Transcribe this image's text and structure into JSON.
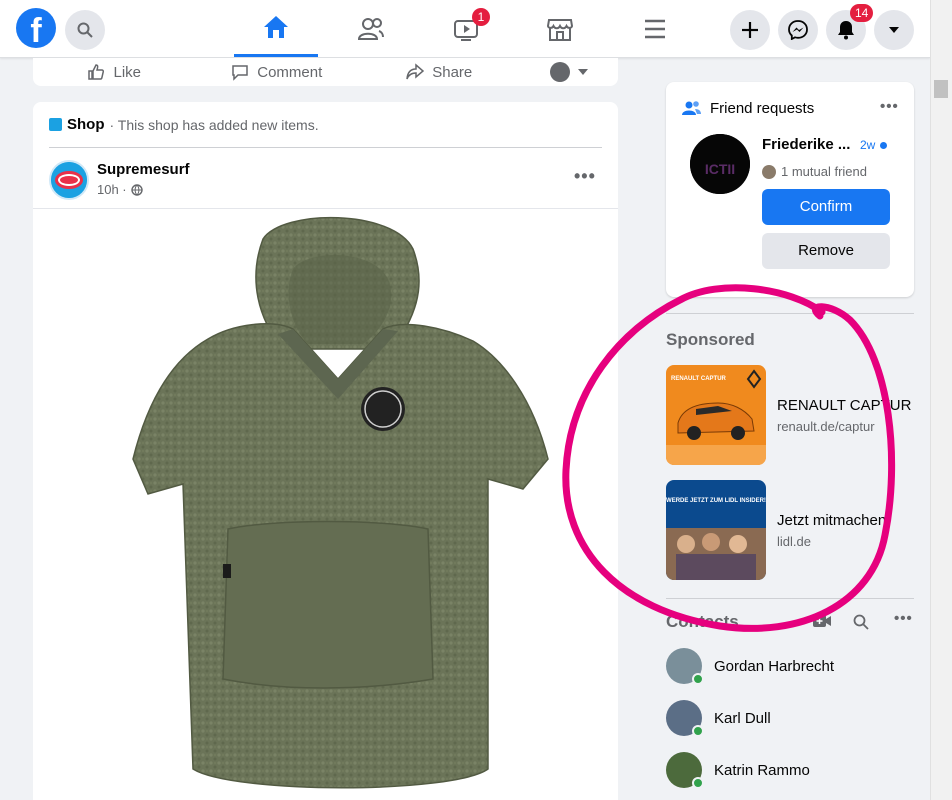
{
  "nav": {
    "logo": "f",
    "tabs": [
      "home-icon",
      "friends-icon",
      "watch-icon",
      "marketplace-icon",
      "menu-icon"
    ],
    "watch_badge": "1",
    "notifications_badge": "14"
  },
  "prev_post": {
    "like": "Like",
    "comment": "Comment",
    "share": "Share"
  },
  "post": {
    "shop_label": "Shop",
    "shop_text": " · This shop has added new items.",
    "author": "Supremesurf",
    "time": "10h ·"
  },
  "friend_requests": {
    "title": "Friend requests",
    "name": "Friederike ...",
    "time": "2w",
    "mutual": "1 mutual friend",
    "confirm": "Confirm",
    "remove": "Remove",
    "avatar_text": "ICTII"
  },
  "sponsored": {
    "title": "Sponsored",
    "ads": [
      {
        "title": "RENAULT CAPTUR",
        "url": "renault.de/captur",
        "img_text": "RENAULT CAPTUR"
      },
      {
        "title": "Jetzt mitmachen!",
        "url": "lidl.de",
        "img_text": "WERDE JETZT ZUM LIDL INSIDER!"
      }
    ]
  },
  "contacts": {
    "title": "Contacts",
    "list": [
      {
        "name": "Gordan Harbrecht"
      },
      {
        "name": "Karl Dull"
      },
      {
        "name": "Katrin Rammo"
      }
    ]
  },
  "colors": {
    "brand": "#1877f2",
    "annotation": "#e6007e",
    "online": "#31a24c"
  }
}
